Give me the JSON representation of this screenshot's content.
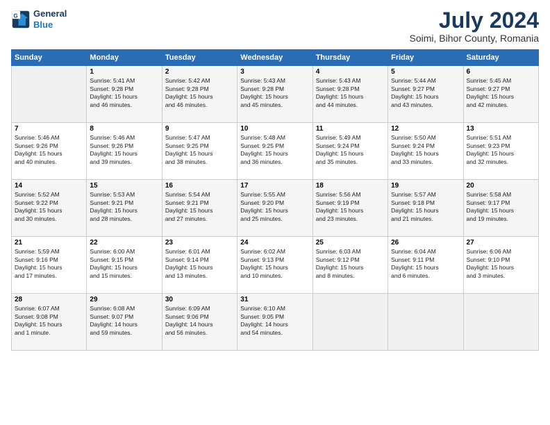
{
  "logo": {
    "line1": "General",
    "line2": "Blue"
  },
  "title": "July 2024",
  "location": "Soimi, Bihor County, Romania",
  "weekdays": [
    "Sunday",
    "Monday",
    "Tuesday",
    "Wednesday",
    "Thursday",
    "Friday",
    "Saturday"
  ],
  "weeks": [
    [
      {
        "day": "",
        "info": ""
      },
      {
        "day": "1",
        "info": "Sunrise: 5:41 AM\nSunset: 9:28 PM\nDaylight: 15 hours\nand 46 minutes."
      },
      {
        "day": "2",
        "info": "Sunrise: 5:42 AM\nSunset: 9:28 PM\nDaylight: 15 hours\nand 46 minutes."
      },
      {
        "day": "3",
        "info": "Sunrise: 5:43 AM\nSunset: 9:28 PM\nDaylight: 15 hours\nand 45 minutes."
      },
      {
        "day": "4",
        "info": "Sunrise: 5:43 AM\nSunset: 9:28 PM\nDaylight: 15 hours\nand 44 minutes."
      },
      {
        "day": "5",
        "info": "Sunrise: 5:44 AM\nSunset: 9:27 PM\nDaylight: 15 hours\nand 43 minutes."
      },
      {
        "day": "6",
        "info": "Sunrise: 5:45 AM\nSunset: 9:27 PM\nDaylight: 15 hours\nand 42 minutes."
      }
    ],
    [
      {
        "day": "7",
        "info": "Sunrise: 5:46 AM\nSunset: 9:26 PM\nDaylight: 15 hours\nand 40 minutes."
      },
      {
        "day": "8",
        "info": "Sunrise: 5:46 AM\nSunset: 9:26 PM\nDaylight: 15 hours\nand 39 minutes."
      },
      {
        "day": "9",
        "info": "Sunrise: 5:47 AM\nSunset: 9:25 PM\nDaylight: 15 hours\nand 38 minutes."
      },
      {
        "day": "10",
        "info": "Sunrise: 5:48 AM\nSunset: 9:25 PM\nDaylight: 15 hours\nand 36 minutes."
      },
      {
        "day": "11",
        "info": "Sunrise: 5:49 AM\nSunset: 9:24 PM\nDaylight: 15 hours\nand 35 minutes."
      },
      {
        "day": "12",
        "info": "Sunrise: 5:50 AM\nSunset: 9:24 PM\nDaylight: 15 hours\nand 33 minutes."
      },
      {
        "day": "13",
        "info": "Sunrise: 5:51 AM\nSunset: 9:23 PM\nDaylight: 15 hours\nand 32 minutes."
      }
    ],
    [
      {
        "day": "14",
        "info": "Sunrise: 5:52 AM\nSunset: 9:22 PM\nDaylight: 15 hours\nand 30 minutes."
      },
      {
        "day": "15",
        "info": "Sunrise: 5:53 AM\nSunset: 9:21 PM\nDaylight: 15 hours\nand 28 minutes."
      },
      {
        "day": "16",
        "info": "Sunrise: 5:54 AM\nSunset: 9:21 PM\nDaylight: 15 hours\nand 27 minutes."
      },
      {
        "day": "17",
        "info": "Sunrise: 5:55 AM\nSunset: 9:20 PM\nDaylight: 15 hours\nand 25 minutes."
      },
      {
        "day": "18",
        "info": "Sunrise: 5:56 AM\nSunset: 9:19 PM\nDaylight: 15 hours\nand 23 minutes."
      },
      {
        "day": "19",
        "info": "Sunrise: 5:57 AM\nSunset: 9:18 PM\nDaylight: 15 hours\nand 21 minutes."
      },
      {
        "day": "20",
        "info": "Sunrise: 5:58 AM\nSunset: 9:17 PM\nDaylight: 15 hours\nand 19 minutes."
      }
    ],
    [
      {
        "day": "21",
        "info": "Sunrise: 5:59 AM\nSunset: 9:16 PM\nDaylight: 15 hours\nand 17 minutes."
      },
      {
        "day": "22",
        "info": "Sunrise: 6:00 AM\nSunset: 9:15 PM\nDaylight: 15 hours\nand 15 minutes."
      },
      {
        "day": "23",
        "info": "Sunrise: 6:01 AM\nSunset: 9:14 PM\nDaylight: 15 hours\nand 13 minutes."
      },
      {
        "day": "24",
        "info": "Sunrise: 6:02 AM\nSunset: 9:13 PM\nDaylight: 15 hours\nand 10 minutes."
      },
      {
        "day": "25",
        "info": "Sunrise: 6:03 AM\nSunset: 9:12 PM\nDaylight: 15 hours\nand 8 minutes."
      },
      {
        "day": "26",
        "info": "Sunrise: 6:04 AM\nSunset: 9:11 PM\nDaylight: 15 hours\nand 6 minutes."
      },
      {
        "day": "27",
        "info": "Sunrise: 6:06 AM\nSunset: 9:10 PM\nDaylight: 15 hours\nand 3 minutes."
      }
    ],
    [
      {
        "day": "28",
        "info": "Sunrise: 6:07 AM\nSunset: 9:08 PM\nDaylight: 15 hours\nand 1 minute."
      },
      {
        "day": "29",
        "info": "Sunrise: 6:08 AM\nSunset: 9:07 PM\nDaylight: 14 hours\nand 59 minutes."
      },
      {
        "day": "30",
        "info": "Sunrise: 6:09 AM\nSunset: 9:06 PM\nDaylight: 14 hours\nand 56 minutes."
      },
      {
        "day": "31",
        "info": "Sunrise: 6:10 AM\nSunset: 9:05 PM\nDaylight: 14 hours\nand 54 minutes."
      },
      {
        "day": "",
        "info": ""
      },
      {
        "day": "",
        "info": ""
      },
      {
        "day": "",
        "info": ""
      }
    ]
  ]
}
